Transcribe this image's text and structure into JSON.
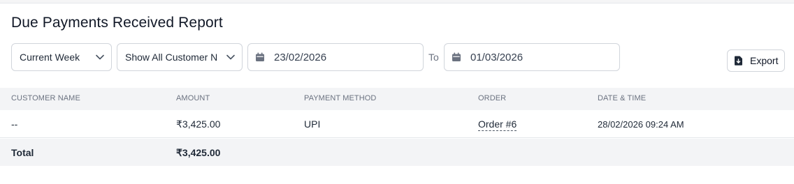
{
  "page": {
    "title": "Due Payments Received Report"
  },
  "filters": {
    "period": "Current Week",
    "customer": "Show All Customer N",
    "date_from": "23/02/2026",
    "to_label": "To",
    "date_to": "01/03/2026"
  },
  "toolbar": {
    "export_label": "Export"
  },
  "table": {
    "columns": [
      "CUSTOMER NAME",
      "AMOUNT",
      "PAYMENT METHOD",
      "ORDER",
      "DATE & TIME"
    ],
    "rows": [
      {
        "customer": "--",
        "amount": "₹3,425.00",
        "method": "UPI",
        "order": "Order #6",
        "datetime": "28/02/2026 09:24 AM"
      }
    ],
    "total": {
      "label": "Total",
      "amount": "₹3,425.00"
    }
  },
  "icons": {
    "chevron": "chevron-down-icon",
    "calendar": "calendar-icon",
    "export": "file-export-icon"
  }
}
